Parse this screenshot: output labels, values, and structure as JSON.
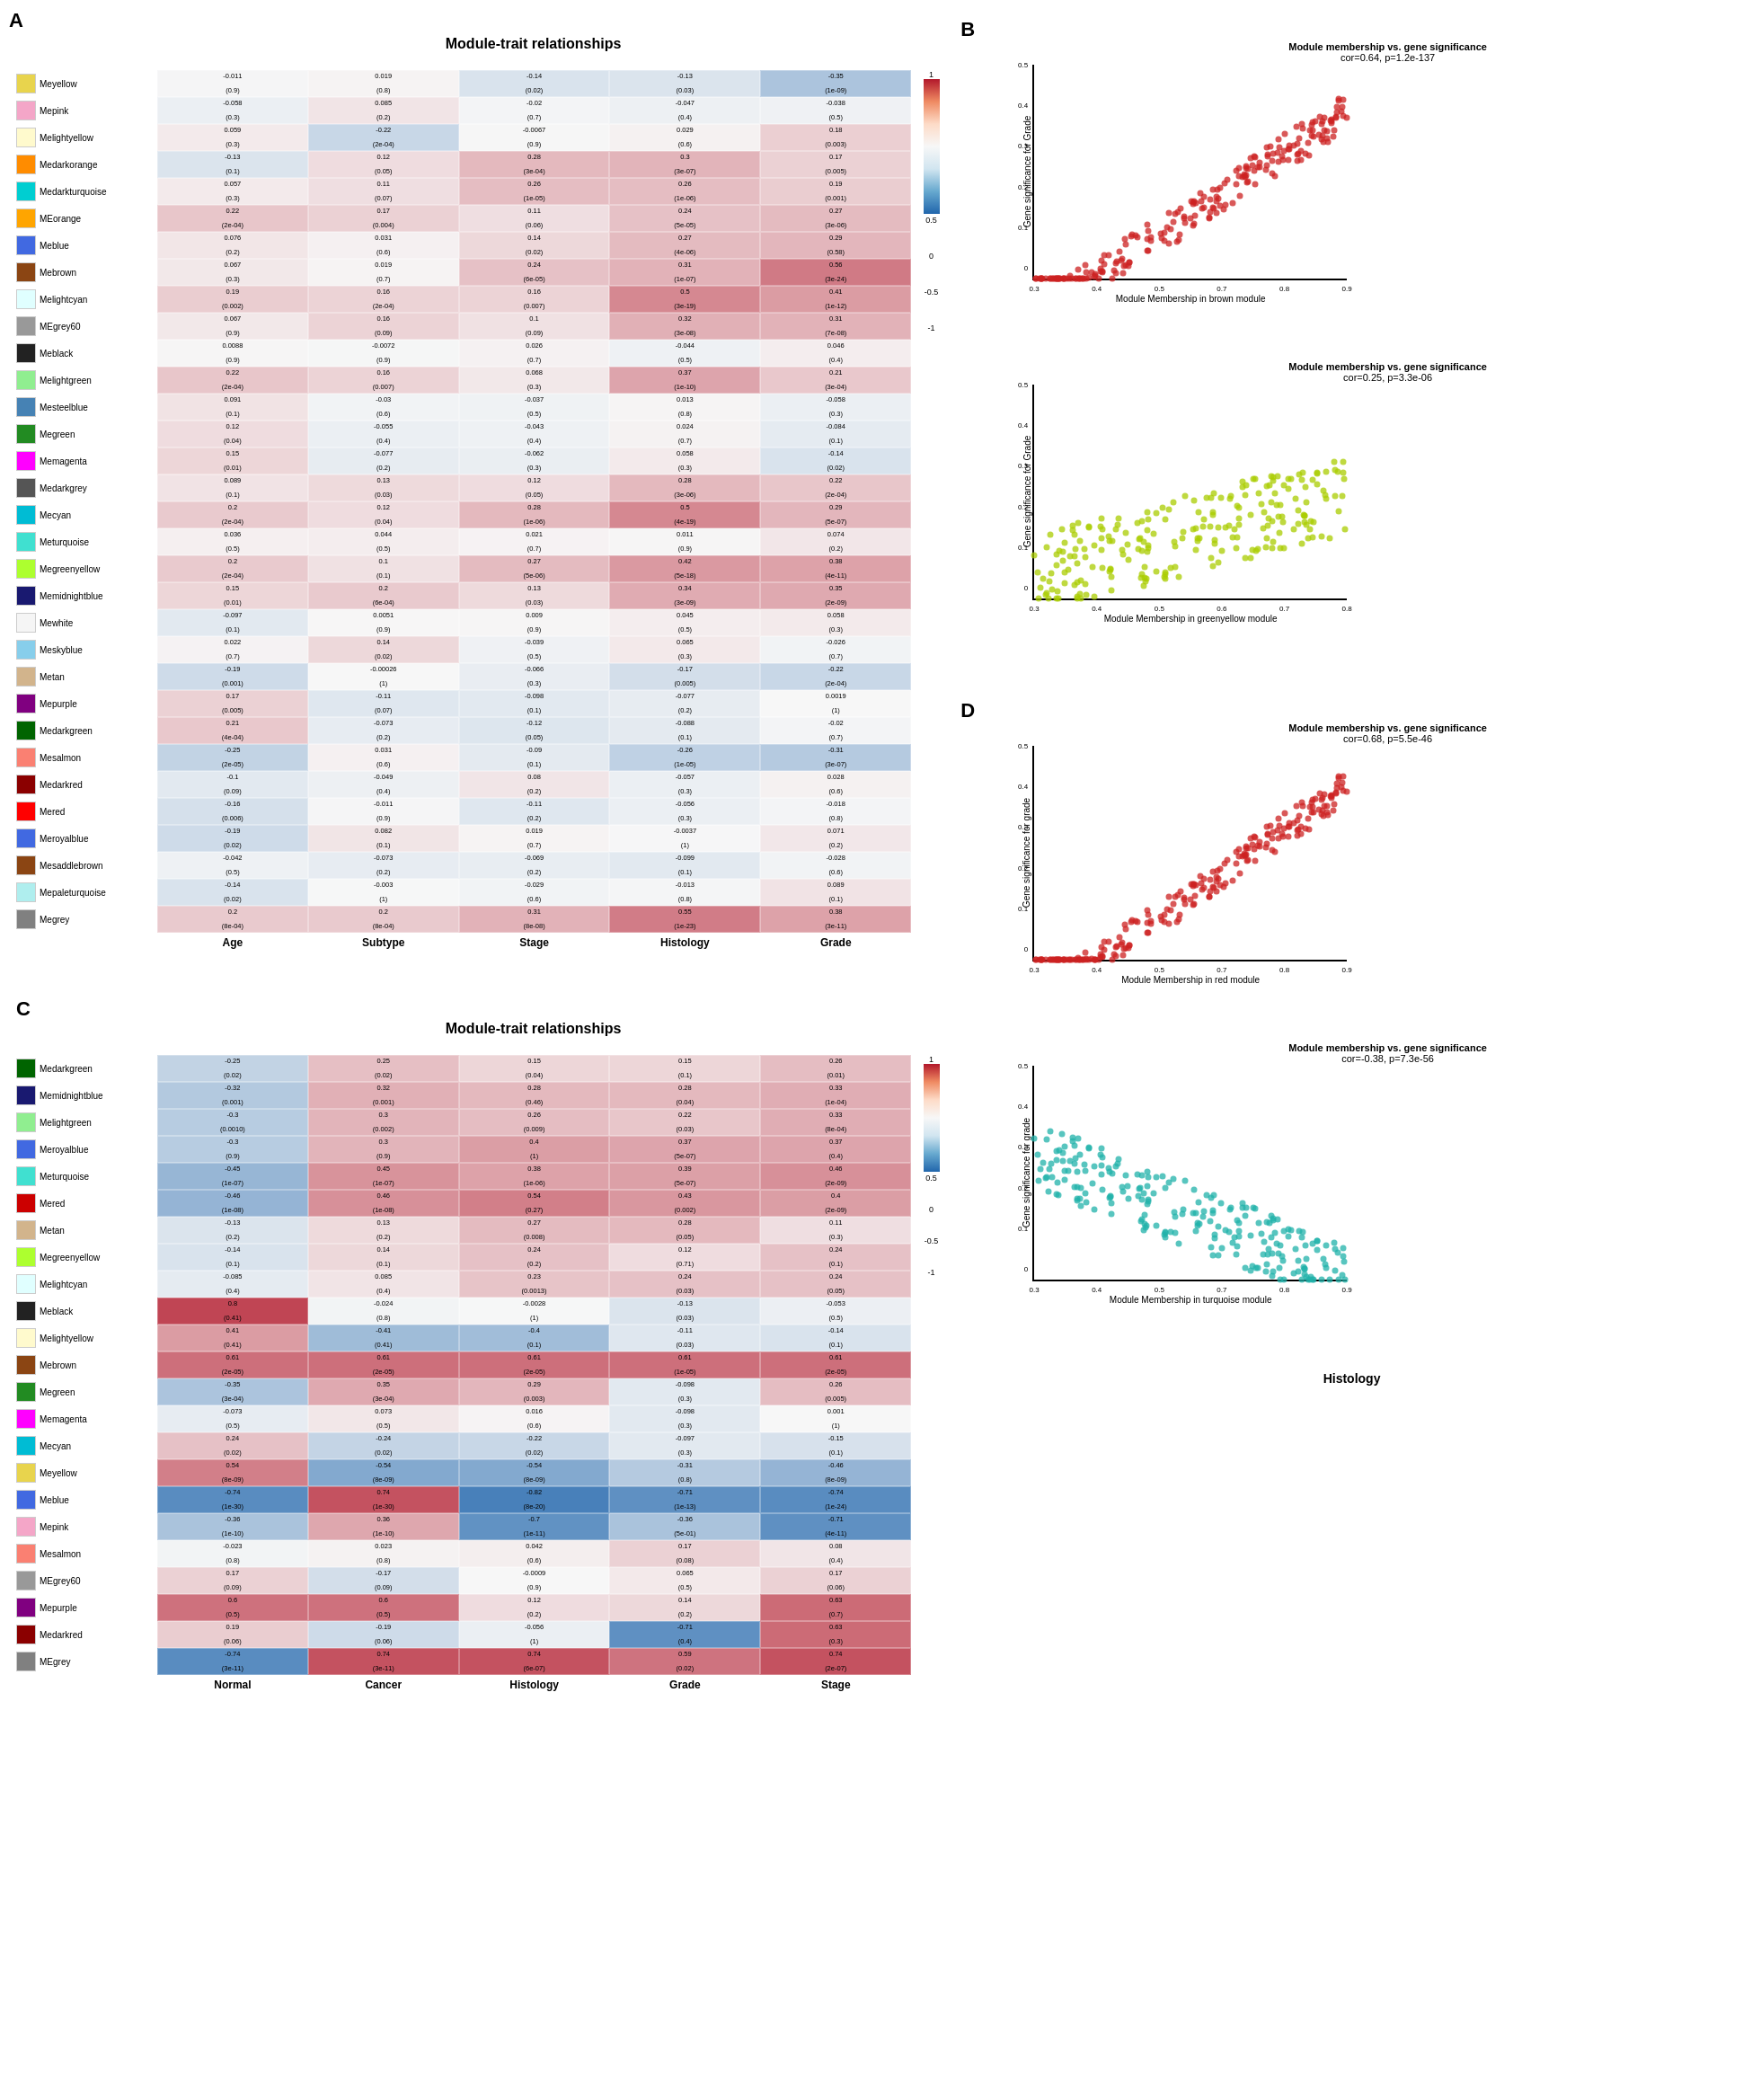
{
  "sectionA": {
    "label": "A",
    "title": "Module-trait relationships",
    "colHeaders": [
      "Age",
      "Subtype",
      "Stage",
      "Histology",
      "Grade"
    ],
    "modules": [
      {
        "name": "Meyellow",
        "color": "#e8d44d"
      },
      {
        "name": "Mepink",
        "color": "#f4a6c8"
      },
      {
        "name": "Melightyellow",
        "color": "#fffacd"
      },
      {
        "name": "Medarkorange",
        "color": "#ff8c00"
      },
      {
        "name": "Medarkturquoise",
        "color": "#00ced1"
      },
      {
        "name": "MEorange",
        "color": "#ffa500"
      },
      {
        "name": "Meblue",
        "color": "#4169e1"
      },
      {
        "name": "Mebrown",
        "color": "#8b4513"
      },
      {
        "name": "Melightcyan",
        "color": "#e0ffff"
      },
      {
        "name": "MEgrey60",
        "color": "#999999"
      },
      {
        "name": "Meblack",
        "color": "#222222"
      },
      {
        "name": "Melightgreen",
        "color": "#90ee90"
      },
      {
        "name": "Mesteelblue",
        "color": "#4682b4"
      },
      {
        "name": "Megreen",
        "color": "#228b22"
      },
      {
        "name": "Memagenta",
        "color": "#ff00ff"
      },
      {
        "name": "Medarkgrey",
        "color": "#555555"
      },
      {
        "name": "Mecyan",
        "color": "#00bcd4"
      },
      {
        "name": "Meturquoise",
        "color": "#40e0d0"
      },
      {
        "name": "Megreenyellow",
        "color": "#adff2f"
      },
      {
        "name": "Memidnightblue",
        "color": "#191970"
      },
      {
        "name": "Mewhite",
        "color": "#f5f5f5"
      },
      {
        "name": "Meskyblue",
        "color": "#87ceeb"
      },
      {
        "name": "Metan",
        "color": "#d2b48c"
      },
      {
        "name": "Mepurple",
        "color": "#800080"
      },
      {
        "name": "Medarkgreen",
        "color": "#006400"
      },
      {
        "name": "Mesalmon",
        "color": "#fa8072"
      },
      {
        "name": "Medarkred",
        "color": "#8b0000"
      },
      {
        "name": "Mered",
        "color": "#ff0000"
      },
      {
        "name": "Meroyalblue",
        "color": "#4169e1"
      },
      {
        "name": "Mesaddlebrown",
        "color": "#8b4513"
      },
      {
        "name": "Mepaleturquoise",
        "color": "#afeeee"
      },
      {
        "name": "Megrey",
        "color": "#808080"
      }
    ],
    "cells": [
      [
        "-0.011\n(0.9)",
        "0.019\n(0.8)",
        "-0.14\n(0.02)",
        "-0.13\n(0.03)",
        "-0.35\n(1e-09)"
      ],
      [
        "-0.058\n(0.3)",
        "0.085\n(0.2)",
        "-0.02\n(0.7)",
        "-0.047\n(0.4)",
        "-0.038\n(0.5)"
      ],
      [
        "0.059\n(0.3)",
        "-0.22\n(2e-04)",
        "-0.0067\n(0.9)",
        "0.029\n(0.6)",
        "0.18\n(0.003)"
      ],
      [
        "-0.13\n(0.1)",
        "0.12\n(0.05)",
        "0.28\n(3e-04)",
        "0.3\n(3e-07)",
        "0.17\n(0.005)"
      ],
      [
        "0.057\n(0.3)",
        "0.11\n(0.07)",
        "0.26\n(1e-05)",
        "0.26\n(1e-06)",
        "0.19\n(0.001)"
      ],
      [
        "0.22\n(2e-04)",
        "0.17\n(0.004)",
        "0.11\n(0.06)",
        "0.24\n(5e-05)",
        "0.27\n(3e-06)"
      ],
      [
        "0.076\n(0.2)",
        "0.031\n(0.6)",
        "0.14\n(0.02)",
        "0.27\n(4e-06)",
        "0.29\n(0.58)"
      ],
      [
        "0.067\n(0.3)",
        "0.019\n(0.7)",
        "0.24\n(6e-05)",
        "0.31\n(1e-07)",
        "0.56\n(3e-24)"
      ],
      [
        "0.19\n(0.002)",
        "0.16\n(2e-04)",
        "0.16\n(0.007)",
        "0.5\n(3e-19)",
        "0.41\n(1e-12)"
      ],
      [
        "0.067\n(0.9)",
        "0.16\n(0.09)",
        "0.1\n(0.09)",
        "0.32\n(3e-08)",
        "0.31\n(7e-08)"
      ],
      [
        "0.0088\n(0.9)",
        "-0.0072\n(0.9)",
        "0.026\n(0.7)",
        "-0.044\n(0.5)",
        "0.046\n(0.4)"
      ],
      [
        "0.22\n(2e-04)",
        "0.16\n(0.007)",
        "0.068\n(0.3)",
        "0.37\n(1e-10)",
        "0.21\n(3e-04)"
      ],
      [
        "0.091\n(0.1)",
        "-0.03\n(0.6)",
        "-0.037\n(0.5)",
        "0.013\n(0.8)",
        "-0.058\n(0.3)"
      ],
      [
        "0.12\n(0.04)",
        "-0.055\n(0.4)",
        "-0.043\n(0.4)",
        "0.024\n(0.7)",
        "-0.084\n(0.1)"
      ],
      [
        "0.15\n(0.01)",
        "-0.077\n(0.2)",
        "-0.062\n(0.3)",
        "0.058\n(0.3)",
        "-0.14\n(0.02)"
      ],
      [
        "0.089\n(0.1)",
        "0.13\n(0.03)",
        "0.12\n(0.05)",
        "0.28\n(3e-06)",
        "0.22\n(2e-04)"
      ],
      [
        "0.2\n(2e-04)",
        "0.12\n(0.04)",
        "0.28\n(1e-06)",
        "0.5\n(4e-19)",
        "0.29\n(5e-07)"
      ],
      [
        "0.036\n(0.5)",
        "0.044\n(0.5)",
        "0.021\n(0.7)",
        "0.011\n(0.9)",
        "0.074\n(0.2)"
      ],
      [
        "0.2\n(2e-04)",
        "0.1\n(0.1)",
        "0.27\n(5e-06)",
        "0.42\n(5e-18)",
        "0.38\n(4e-11)"
      ],
      [
        "0.15\n(0.01)",
        "0.2\n(6e-04)",
        "0.13\n(0.03)",
        "0.34\n(3e-09)",
        "0.35\n(2e-09)"
      ],
      [
        "-0.097\n(0.1)",
        "0.0051\n(0.9)",
        "0.009\n(0.9)",
        "0.045\n(0.5)",
        "0.058\n(0.3)"
      ],
      [
        "0.022\n(0.7)",
        "0.14\n(0.02)",
        "-0.039\n(0.5)",
        "0.065\n(0.3)",
        "-0.026\n(0.7)"
      ],
      [
        "-0.19\n(0.001)",
        "-0.00026\n(1)",
        "-0.066\n(0.3)",
        "-0.17\n(0.005)",
        "-0.22\n(2e-04)"
      ],
      [
        "0.17\n(0.005)",
        "-0.11\n(0.07)",
        "-0.098\n(0.1)",
        "-0.077\n(0.2)",
        "0.0019\n(1)"
      ],
      [
        "0.21\n(4e-04)",
        "-0.073\n(0.2)",
        "-0.12\n(0.05)",
        "-0.088\n(0.1)",
        "-0.02\n(0.7)"
      ],
      [
        "-0.25\n(2e-05)",
        "0.031\n(0.6)",
        "-0.09\n(0.1)",
        "-0.26\n(1e-05)",
        "-0.31\n(3e-07)"
      ],
      [
        "-0.1\n(0.09)",
        "-0.049\n(0.4)",
        "0.08\n(0.2)",
        "-0.057\n(0.3)",
        "0.028\n(0.6)"
      ],
      [
        "-0.16\n(0.006)",
        "-0.011\n(0.9)",
        "-0.11\n(0.2)",
        "-0.056\n(0.3)",
        "-0.018\n(0.8)"
      ],
      [
        "-0.19\n(0.02)",
        "0.082\n(0.1)",
        "0.019\n(0.7)",
        "-0.0037\n(1)",
        "0.071\n(0.2)"
      ],
      [
        "-0.042\n(0.5)",
        "-0.073\n(0.2)",
        "-0.069\n(0.2)",
        "-0.099\n(0.1)",
        "-0.028\n(0.6)"
      ],
      [
        "-0.14\n(0.02)",
        "-0.003\n(1)",
        "-0.029\n(0.6)",
        "-0.013\n(0.8)",
        "0.089\n(0.1)"
      ],
      [
        "0.2\n(8e-04)",
        "0.2\n(8e-04)",
        "0.31\n(8e-08)",
        "0.55\n(1e-23)",
        "0.38\n(3e-11)"
      ]
    ]
  },
  "sectionB": {
    "label": "B",
    "plots": [
      {
        "title": "Module membership vs. gene significance",
        "subtitle": "cor=0.64, p=1.2e-137",
        "xLabel": "Module Membership in brown module",
        "yLabel": "Gene significance for Grade",
        "color": "#cc2222",
        "xRange": [
          0.3,
          0.9
        ],
        "yRange": [
          0,
          0.5
        ]
      },
      {
        "title": "Module membership vs. gene significance",
        "subtitle": "cor=0.25, p=3.3e-06",
        "xLabel": "Module Membership in greenyellow module",
        "yLabel": "Gene significance for Grade",
        "color": "#aacc00",
        "xRange": [
          0.3,
          0.8
        ],
        "yRange": [
          0,
          0.5
        ]
      }
    ]
  },
  "sectionC": {
    "label": "C",
    "title": "Module-trait relationships",
    "colHeaders": [
      "Normal",
      "Cancer",
      "Histology",
      "Grade",
      "Stage"
    ],
    "modules": [
      {
        "name": "Medarkgreen",
        "color": "#006400"
      },
      {
        "name": "Memidnightblue",
        "color": "#191970"
      },
      {
        "name": "Melightgreen",
        "color": "#90ee90"
      },
      {
        "name": "Meroyalblue",
        "color": "#4169e1"
      },
      {
        "name": "Meturquoise",
        "color": "#40e0d0"
      },
      {
        "name": "Mered",
        "color": "#cc0000"
      },
      {
        "name": "Metan",
        "color": "#d2b48c"
      },
      {
        "name": "Megreenyellow",
        "color": "#adff2f"
      },
      {
        "name": "Melightcyan",
        "color": "#e0ffff"
      },
      {
        "name": "Meblack",
        "color": "#222222"
      },
      {
        "name": "Melightyellow",
        "color": "#fffacd"
      },
      {
        "name": "Mebrown",
        "color": "#8b4513"
      },
      {
        "name": "Megreen",
        "color": "#228b22"
      },
      {
        "name": "Memagenta",
        "color": "#ff00ff"
      },
      {
        "name": "Mecyan",
        "color": "#00bcd4"
      },
      {
        "name": "Meyellow",
        "color": "#e8d44d"
      },
      {
        "name": "Meblue",
        "color": "#4169e1"
      },
      {
        "name": "Mepink",
        "color": "#f4a6c8"
      },
      {
        "name": "Mesalmon",
        "color": "#fa8072"
      },
      {
        "name": "MEgrey60",
        "color": "#999999"
      },
      {
        "name": "Mepurple",
        "color": "#800080"
      },
      {
        "name": "Medarkred",
        "color": "#8b0000"
      },
      {
        "name": "MEgrey",
        "color": "#808080"
      }
    ],
    "cells": [
      [
        "-0.25\n(0.02)",
        "0.25\n(0.02)",
        "0.15\n(0.04)",
        "0.15\n(0.1)",
        "0.26\n(0.01)"
      ],
      [
        "-0.32\n(0.001)",
        "0.32\n(0.001)",
        "0.28\n(0.46)",
        "0.28\n(0.04)",
        "0.33\n(1e-04)"
      ],
      [
        "-0.3\n(0.0010)",
        "0.3\n(0.002)",
        "0.26\n(0.009)",
        "0.22\n(0.03)",
        "0.33\n(8e-04)"
      ],
      [
        "-0.3\n(0.9)",
        "0.3\n(0.9)",
        "0.4\n(1)",
        "0.37\n(5e-07)",
        "0.37\n(0.4)"
      ],
      [
        "-0.45\n(1e-07)",
        "0.45\n(1e-07)",
        "0.38\n(1e-06)",
        "0.39\n(5e-07)",
        "0.46\n(2e-09)"
      ],
      [
        "-0.46\n(1e-08)",
        "0.46\n(1e-08)",
        "0.54\n(0.27)",
        "0.43\n(0.002)",
        "0.4\n(2e-09)"
      ],
      [
        "-0.13\n(0.2)",
        "0.13\n(0.2)",
        "0.27\n(0.008)",
        "0.28\n(0.05)",
        "0.11\n(0.3)"
      ],
      [
        "-0.14\n(0.1)",
        "0.14\n(0.1)",
        "0.24\n(0.2)",
        "0.12\n(0.71)",
        "0.24\n(0.1)"
      ],
      [
        "-0.085\n(0.4)",
        "0.085\n(0.4)",
        "0.23\n(0.0013)",
        "0.24\n(0.03)",
        "0.24\n(0.05)"
      ],
      [
        "0.8\n(0.41)",
        "-0.024\n(0.8)",
        "-0.0028\n(1)",
        "-0.13\n(0.03)",
        "-0.053\n(0.5)"
      ],
      [
        "0.41\n(0.41)",
        "-0.41\n(0.41)",
        "-0.4\n(0.1)",
        "-0.11\n(0.03)",
        "-0.14\n(0.1)"
      ],
      [
        "0.61\n(2e-05)",
        "0.61\n(2e-05)",
        "0.61\n(2e-05)",
        "0.61\n(1e-05)",
        "0.61\n(2e-05)"
      ],
      [
        "-0.35\n(3e-04)",
        "0.35\n(3e-04)",
        "0.29\n(0.003)",
        "-0.098\n(0.3)",
        "0.26\n(0.005)"
      ],
      [
        "-0.073\n(0.5)",
        "0.073\n(0.5)",
        "0.016\n(0.6)",
        "-0.098\n(0.3)",
        "0.001\n(1)"
      ],
      [
        "0.24\n(0.02)",
        "-0.24\n(0.02)",
        "-0.22\n(0.02)",
        "-0.097\n(0.3)",
        "-0.15\n(0.1)"
      ],
      [
        "0.54\n(8e-09)",
        "-0.54\n(8e-09)",
        "-0.54\n(8e-09)",
        "-0.31\n(0.8)",
        "-0.46\n(8e-09)"
      ],
      [
        "-0.74\n(1e-30)",
        "0.74\n(1e-30)",
        "-0.82\n(8e-20)",
        "-0.71\n(1e-13)",
        "-0.74\n(1e-24)"
      ],
      [
        "-0.36\n(1e-10)",
        "0.36\n(1e-10)",
        "-0.7\n(1e-11)",
        "-0.36\n(5e-01)",
        "-0.71\n(4e-11)"
      ],
      [
        "-0.023\n(0.8)",
        "0.023\n(0.8)",
        "0.042\n(0.6)",
        "0.17\n(0.08)",
        "0.08\n(0.4)"
      ],
      [
        "0.17\n(0.09)",
        "-0.17\n(0.09)",
        "-0.0009\n(0.9)",
        "0.065\n(0.5)",
        "0.17\n(0.06)"
      ],
      [
        "0.6\n(0.5)",
        "0.6\n(0.5)",
        "0.12\n(0.2)",
        "0.14\n(0.2)",
        "0.63\n(0.7)"
      ],
      [
        "0.19\n(0.06)",
        "-0.19\n(0.06)",
        "-0.056\n(1)",
        "-0.71\n(0.4)",
        "0.63\n(0.3)"
      ],
      [
        "-0.74\n(3e-11)",
        "0.74\n(3e-11)",
        "0.74\n(6e-07)",
        "0.59\n(0.02)",
        "0.74\n(2e-07)"
      ]
    ]
  },
  "sectionD": {
    "label": "D",
    "plots": [
      {
        "title": "Module membership vs. gene significance",
        "subtitle": "cor=0.68, p=5.5e-46",
        "xLabel": "Module Membership in red module",
        "yLabel": "Gene significance for grade",
        "color": "#cc2222",
        "xRange": [
          0.3,
          0.9
        ],
        "yRange": [
          0,
          0.8
        ]
      },
      {
        "title": "Module membership vs. gene significance",
        "subtitle": "cor=-0.38, p=7.3e-56",
        "xLabel": "Module Membership in turquoise module",
        "yLabel": "Gene significance for grade",
        "color": "#20b2aa",
        "xRange": [
          0.3,
          0.9
        ],
        "yRange": [
          0,
          0.4
        ]
      }
    ]
  },
  "histologyLabel": "Histology"
}
